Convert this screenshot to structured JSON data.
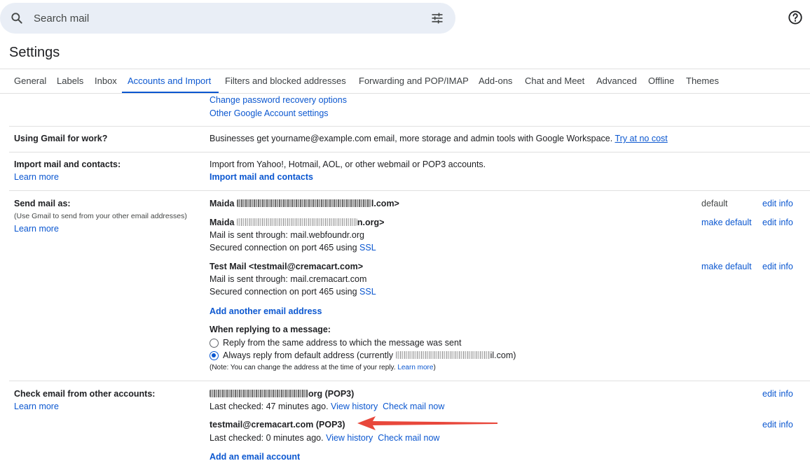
{
  "search": {
    "placeholder": "Search mail"
  },
  "page_title": "Settings",
  "tabs": [
    {
      "label": "General"
    },
    {
      "label": "Labels"
    },
    {
      "label": "Inbox"
    },
    {
      "label": "Accounts and Import",
      "active": true
    },
    {
      "label": "Filters and blocked addresses"
    },
    {
      "label": "Forwarding and POP/IMAP"
    },
    {
      "label": "Add-ons"
    },
    {
      "label": "Chat and Meet"
    },
    {
      "label": "Advanced"
    },
    {
      "label": "Offline"
    },
    {
      "label": "Themes"
    }
  ],
  "account_links": {
    "change_password_recovery": "Change password recovery options",
    "other_google_settings": "Other Google Account settings"
  },
  "gmail_for_work": {
    "label": "Using Gmail for work?",
    "text": "Businesses get yourname@example.com email, more storage and admin tools with Google Workspace. ",
    "link": "Try at no cost"
  },
  "import_mail": {
    "label": "Import mail and contacts:",
    "learn_more": "Learn more",
    "text": "Import from Yahoo!, Hotmail, AOL, or other webmail or POP3 accounts.",
    "action": "Import mail and contacts"
  },
  "send_mail_as": {
    "label": "Send mail as:",
    "sublabel": "(Use Gmail to send from your other email addresses)",
    "learn_more": "Learn more",
    "addresses": [
      {
        "name_start": "Maida ",
        "name_end": "l.com>",
        "status": "default",
        "edit": "edit info"
      },
      {
        "name_start": "Maida ",
        "name_end": "n.org>",
        "line2": "Mail is sent through: mail.webfoundr.org",
        "line3_prefix": "Secured connection on port 465 using ",
        "line3_link": "SSL",
        "make_default": "make default",
        "edit": "edit info"
      },
      {
        "name": "Test Mail <testmail@cremacart.com>",
        "line2": "Mail is sent through: mail.cremacart.com",
        "line3_prefix": "Secured connection on port 465 using ",
        "line3_link": "SSL",
        "make_default": "make default",
        "edit": "edit info"
      }
    ],
    "add_another": "Add another email address",
    "replying_heading": "When replying to a message:",
    "reply_same": "Reply from the same address to which the message was sent",
    "reply_default_prefix": "Always reply from default address (currently ",
    "reply_default_suffix": "il.com)",
    "note_prefix": "(Note: You can change the address at the time of your reply. ",
    "note_link": "Learn more",
    "note_suffix": ")"
  },
  "check_email": {
    "label": "Check email from other accounts:",
    "learn_more": "Learn more",
    "accounts": [
      {
        "name_suffix": "org (POP3)",
        "last_checked": "Last checked: 47 minutes ago. ",
        "view_history": "View history",
        "check_now": "Check mail now",
        "edit": "edit info"
      },
      {
        "name": "testmail@cremacart.com (POP3)",
        "last_checked": "Last checked: 0 minutes ago. ",
        "view_history": "View history",
        "check_now": "Check mail now",
        "edit": "edit info"
      }
    ],
    "add_account": "Add an email account"
  },
  "colors": {
    "link": "#0b57d0",
    "search_bg": "#e9eef6",
    "arrow": "#e8473b"
  },
  "icons": [
    "search-icon",
    "tune-icon",
    "help-icon",
    "arrow-annotation"
  ]
}
